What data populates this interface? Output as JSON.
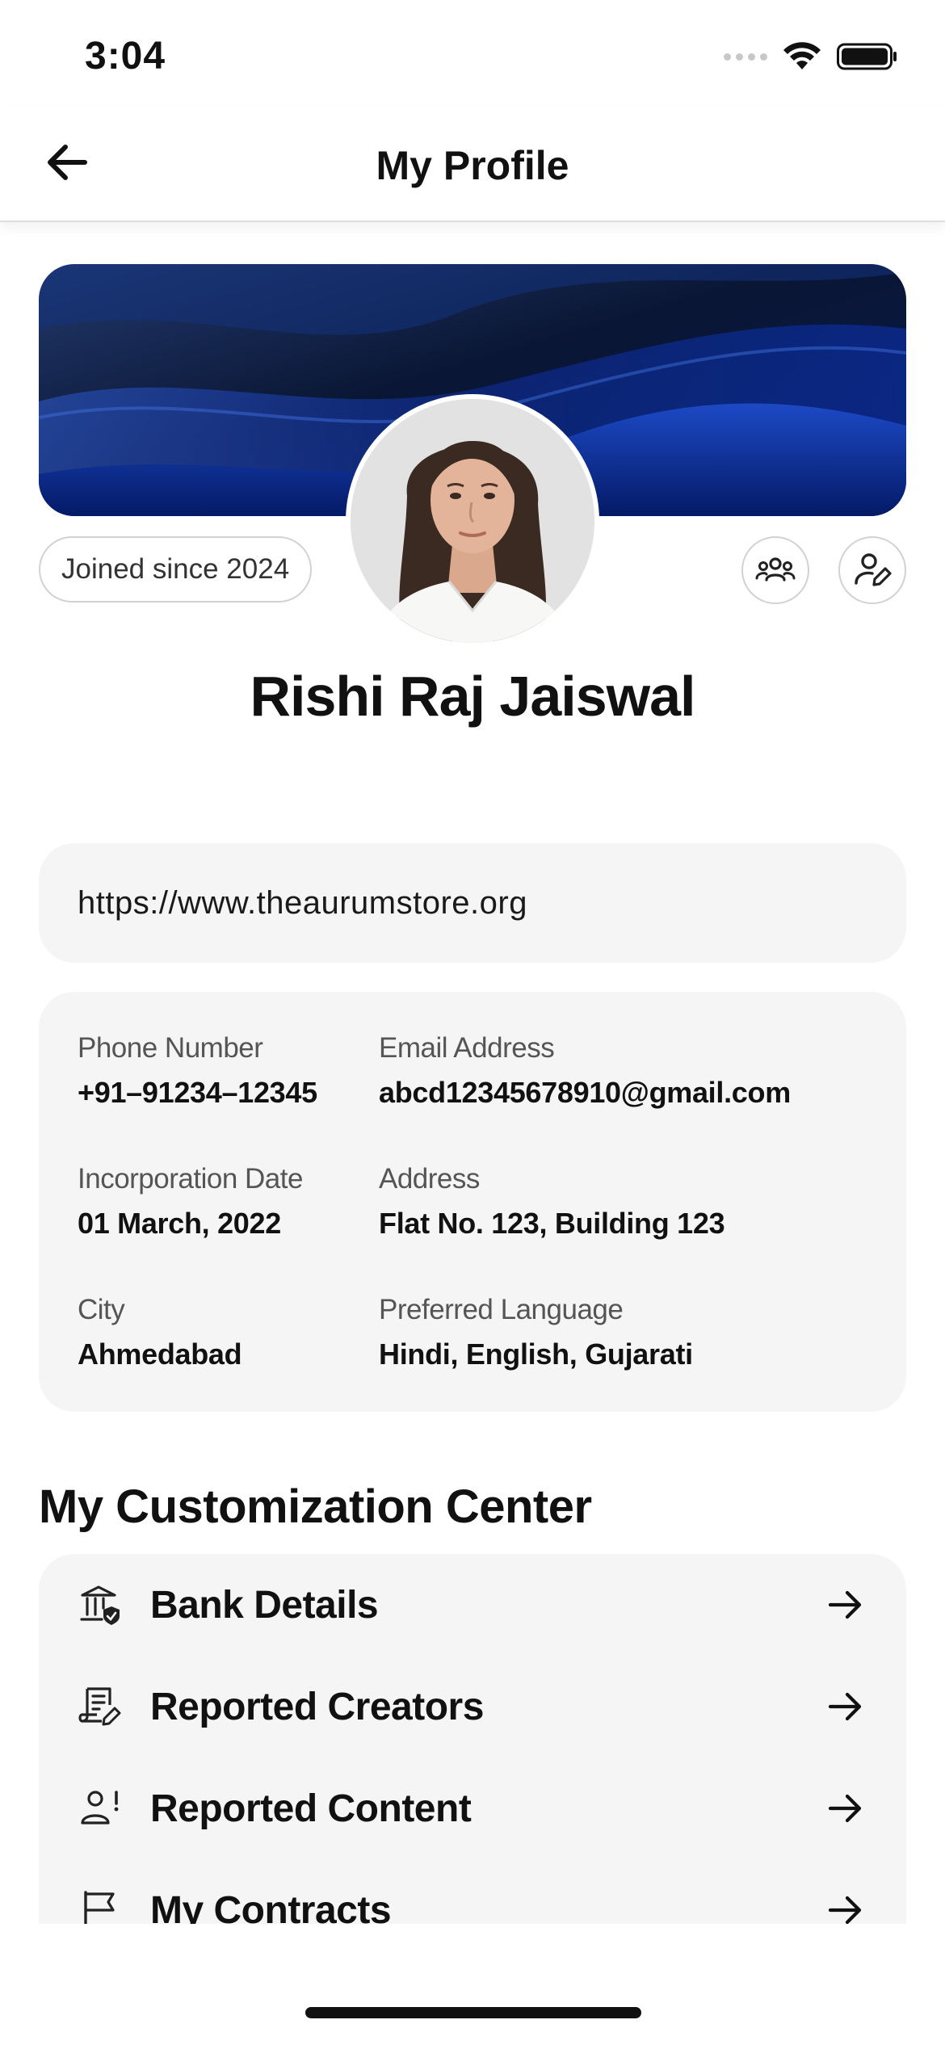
{
  "status_bar": {
    "time": "3:04"
  },
  "header": {
    "title": "My Profile"
  },
  "profile": {
    "joined": "Joined since 2024",
    "name": "Rishi Raj Jaiswal",
    "website": "https://www.theaurumstore.org"
  },
  "details": [
    {
      "label": "Phone Number",
      "value": "+91–91234–12345"
    },
    {
      "label": "Email Address",
      "value": "abcd12345678910@gmail.com"
    },
    {
      "label": "Incorporation Date",
      "value": "01 March, 2022"
    },
    {
      "label": "Address",
      "value": "Flat No. 123, Building 123"
    },
    {
      "label": "City",
      "value": "Ahmedabad"
    },
    {
      "label": "Preferred Language",
      "value": "Hindi, English, Gujarati"
    }
  ],
  "customization": {
    "title": "My Customization Center",
    "items": [
      {
        "label": "Bank Details",
        "icon": "bank-shield-icon"
      },
      {
        "label": "Reported Creators",
        "icon": "report-edit-icon"
      },
      {
        "label": "Reported Content",
        "icon": "user-alert-icon"
      },
      {
        "label": "My Contracts",
        "icon": "flag-icon"
      }
    ]
  },
  "colors": {
    "banner_dark": "#0b1a3f",
    "banner_blue": "#1c49c6",
    "card_bg": "#f5f5f5"
  }
}
